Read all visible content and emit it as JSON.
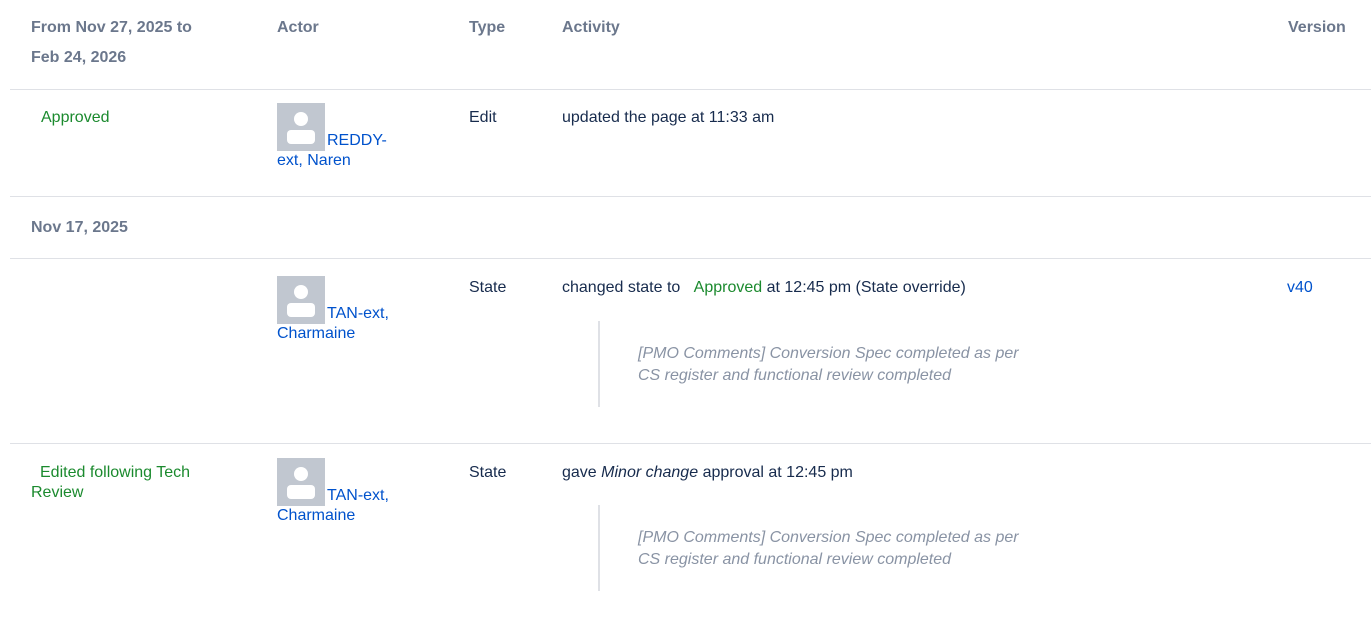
{
  "header": {
    "date_range_line1": "From Nov 27, 2025 to",
    "date_range_line2": "Feb 24, 2026",
    "actor": "Actor",
    "type": "Type",
    "activity": "Activity",
    "version": "Version"
  },
  "rows": [
    {
      "state": "Approved",
      "actor_line1": "REDDY-",
      "actor_line2": "ext, Naren",
      "type": "Edit",
      "activity": "updated the page at 11:33 am"
    }
  ],
  "date_group_2": "Nov 17, 2025",
  "row2": {
    "actor_line1": "TAN-ext,",
    "actor_line2": "Charmaine",
    "type": "State",
    "activity_prefix": "changed state to",
    "activity_state": "Approved",
    "activity_suffix": "at 12:45 pm (State override)",
    "version": "v40",
    "comment_line1": "[PMO Comments] Conversion Spec completed as per",
    "comment_line2": "CS register and functional review completed"
  },
  "row3": {
    "state_line1": "Edited following Tech",
    "state_line2": "Review",
    "actor_line1": "TAN-ext,",
    "actor_line2": "Charmaine",
    "type": "State",
    "activity_prefix": "gave",
    "activity_emph": "Minor change",
    "activity_suffix": "approval at 12:45 pm",
    "comment_line1": "[PMO Comments] Conversion Spec completed as per",
    "comment_line2": "CS register and functional review completed"
  },
  "colors": {
    "state_green": "#1b8a2e",
    "link_blue": "#0052cc",
    "header_grey": "#6b778c",
    "comment_grey": "#8993a4"
  },
  "icons": {
    "avatar": "default-user-avatar-icon"
  }
}
